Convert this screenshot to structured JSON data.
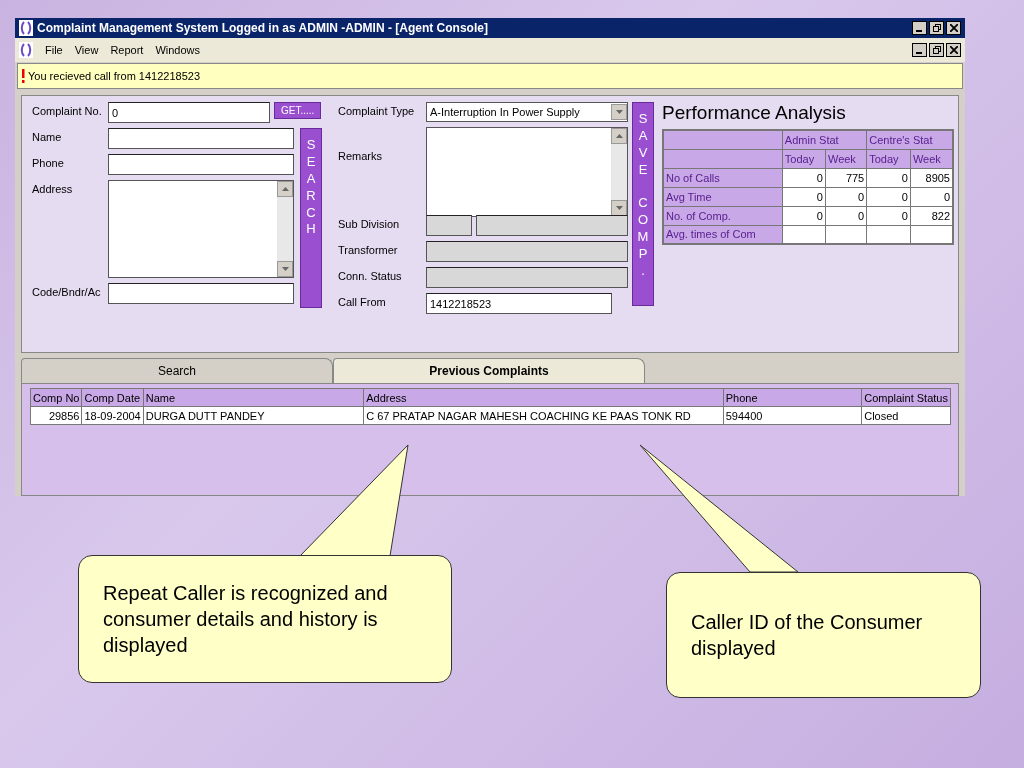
{
  "window": {
    "title": "Complaint Management System Logged in as ADMIN -ADMIN - [Agent Console]"
  },
  "menu": [
    "File",
    "View",
    "Report",
    "Windows"
  ],
  "alert": {
    "message": "You recieved call from 1412218523"
  },
  "form": {
    "complaint_no": {
      "label": "Complaint No.",
      "value": "0"
    },
    "get_button": "GET.....",
    "name": {
      "label": "Name"
    },
    "phone": {
      "label": "Phone"
    },
    "address": {
      "label": "Address"
    },
    "code": {
      "label": "Code/Bndr/Ac"
    },
    "search_button": "SEARCH",
    "complaint_type": {
      "label": "Complaint Type",
      "value": "A-Interruption In Power Supply"
    },
    "remarks": {
      "label": "Remarks"
    },
    "sub_division": {
      "label": "Sub Division"
    },
    "transformer": {
      "label": "Transformer"
    },
    "conn_status": {
      "label": "Conn. Status"
    },
    "call_from": {
      "label": "Call From",
      "value": "1412218523"
    },
    "save_button": "SAVE COMP."
  },
  "performance": {
    "title": "Performance Analysis",
    "groups": [
      "Admin Stat",
      "Centre's Stat"
    ],
    "subheads": [
      "Today",
      "Week",
      "Today",
      "Week"
    ],
    "rows": [
      {
        "label": "No of Calls",
        "values": [
          "0",
          "775",
          "0",
          "8905"
        ]
      },
      {
        "label": "Avg Time",
        "values": [
          "0",
          "0",
          "0",
          "0"
        ]
      },
      {
        "label": "No. of Comp.",
        "values": [
          "0",
          "0",
          "0",
          "822"
        ]
      },
      {
        "label": "Avg. times of Com"
      }
    ]
  },
  "tabs": [
    {
      "label": "Search",
      "selected": false
    },
    {
      "label": "Previous Complaints",
      "selected": true
    }
  ],
  "table": {
    "columns": [
      "Comp No",
      "Comp Date",
      "Name",
      "Address",
      "Phone",
      "Complaint Status"
    ],
    "rows": [
      [
        "29856",
        "18-09-2004",
        "DURGA DUTT PANDEY",
        "C 67 PRATAP NAGAR MAHESH COACHING KE PAAS TONK RD",
        "594400",
        "Closed"
      ]
    ]
  },
  "callouts": [
    {
      "text": "Repeat Caller is recognized and consumer details and history is displayed"
    },
    {
      "text": "Caller ID of the Consumer displayed"
    }
  ]
}
